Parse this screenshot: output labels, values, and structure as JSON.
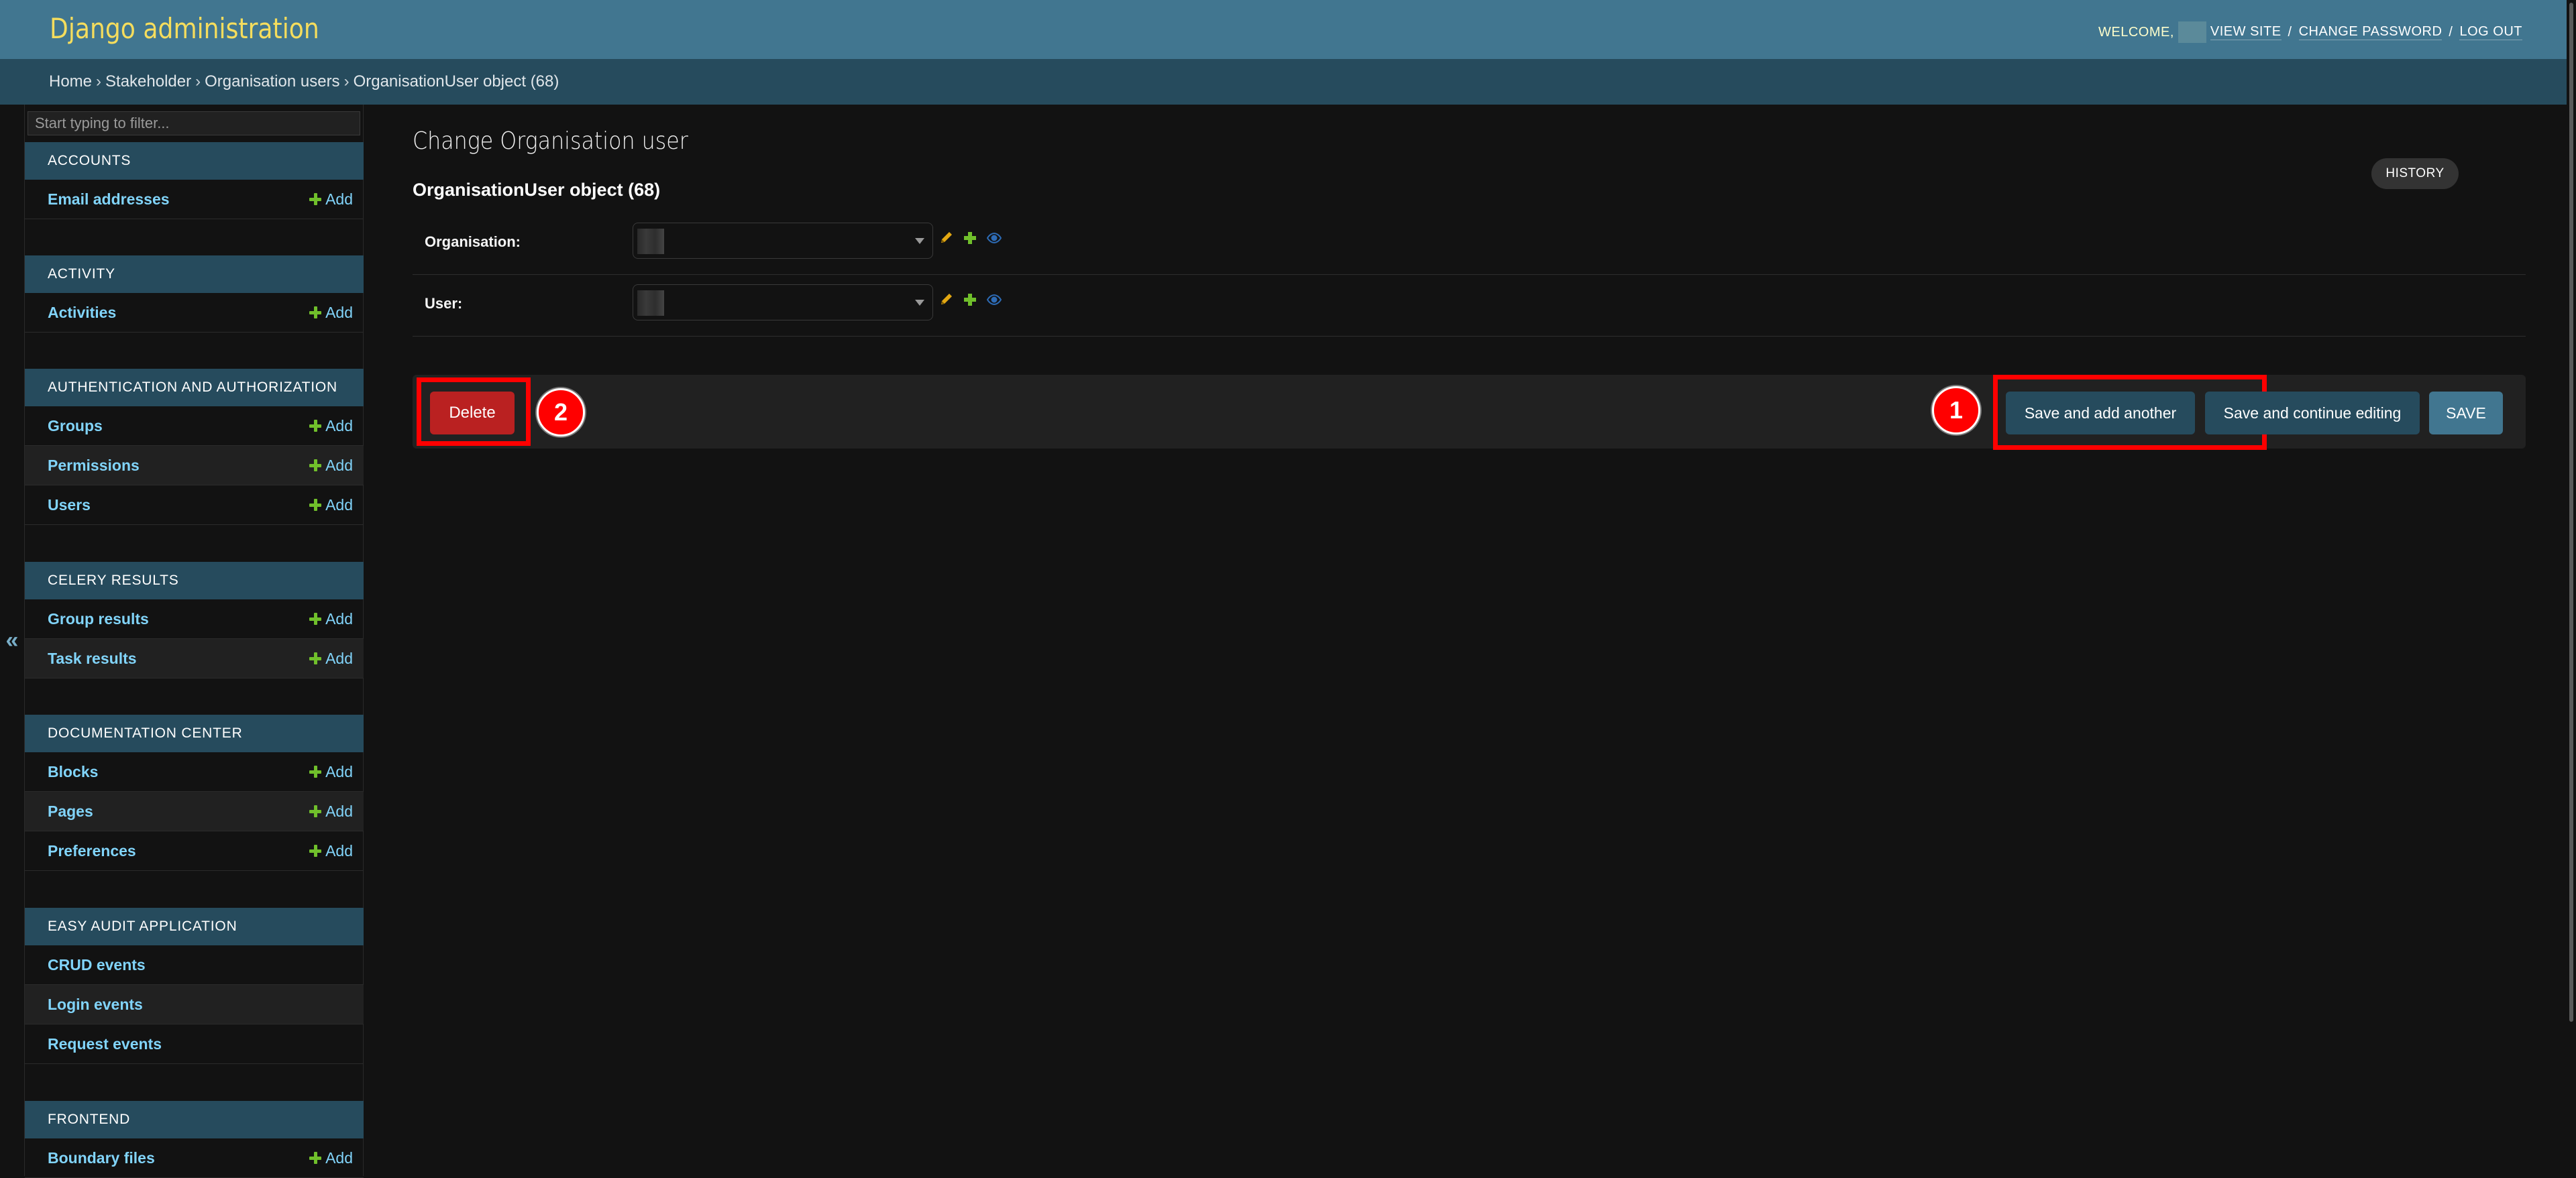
{
  "header": {
    "branding": "Django administration",
    "welcome": "WELCOME,",
    "user_tools": [
      {
        "label": "VIEW SITE"
      },
      {
        "label": "CHANGE PASSWORD"
      },
      {
        "label": "LOG OUT"
      }
    ],
    "separator": "/"
  },
  "breadcrumbs": {
    "items": [
      "Home",
      "Stakeholder",
      "Organisation users",
      "OrganisationUser object (68)"
    ],
    "separator": "›"
  },
  "sidebar": {
    "toggle_icon": "«",
    "filter_placeholder": "Start typing to filter...",
    "add_label": "Add",
    "modules": [
      {
        "caption": "ACCOUNTS",
        "models": [
          {
            "name": "Email addresses",
            "add": true
          }
        ]
      },
      {
        "caption": "ACTIVITY",
        "models": [
          {
            "name": "Activities",
            "add": true
          }
        ]
      },
      {
        "caption": "AUTHENTICATION AND AUTHORIZATION",
        "models": [
          {
            "name": "Groups",
            "add": true
          },
          {
            "name": "Permissions",
            "add": true
          },
          {
            "name": "Users",
            "add": true
          }
        ]
      },
      {
        "caption": "CELERY RESULTS",
        "models": [
          {
            "name": "Group results",
            "add": true
          },
          {
            "name": "Task results",
            "add": true
          }
        ]
      },
      {
        "caption": "DOCUMENTATION CENTER",
        "models": [
          {
            "name": "Blocks",
            "add": true
          },
          {
            "name": "Pages",
            "add": true
          },
          {
            "name": "Preferences",
            "add": true
          }
        ]
      },
      {
        "caption": "EASY AUDIT APPLICATION",
        "models": [
          {
            "name": "CRUD events",
            "add": false
          },
          {
            "name": "Login events",
            "add": false
          },
          {
            "name": "Request events",
            "add": false
          }
        ]
      },
      {
        "caption": "FRONTEND",
        "models": [
          {
            "name": "Boundary files",
            "add": true
          }
        ]
      }
    ]
  },
  "content": {
    "title": "Change Organisation user",
    "history_label": "HISTORY",
    "object_title": "OrganisationUser object (68)",
    "fields": [
      {
        "label": "Organisation:",
        "value": "",
        "icons": [
          "pencil-icon",
          "plus-icon",
          "eye-icon"
        ]
      },
      {
        "label": "User:",
        "value": "",
        "icons": [
          "pencil-icon",
          "plus-icon",
          "eye-icon"
        ]
      }
    ],
    "submit": {
      "delete_label": "Delete",
      "save_add_another_label": "Save and add another",
      "save_continue_label": "Save and continue editing",
      "save_label": "SAVE"
    },
    "annotations": {
      "badge_1": "1",
      "badge_2": "2"
    }
  },
  "colors": {
    "header_bg": "#417690",
    "breadcrumb_bg": "#264b5d",
    "branding": "#f5dd5d",
    "link": "#81d4fa",
    "add_plus": "#70bf2b",
    "delete_bg": "#ba2121",
    "highlight": "#ff0000"
  }
}
